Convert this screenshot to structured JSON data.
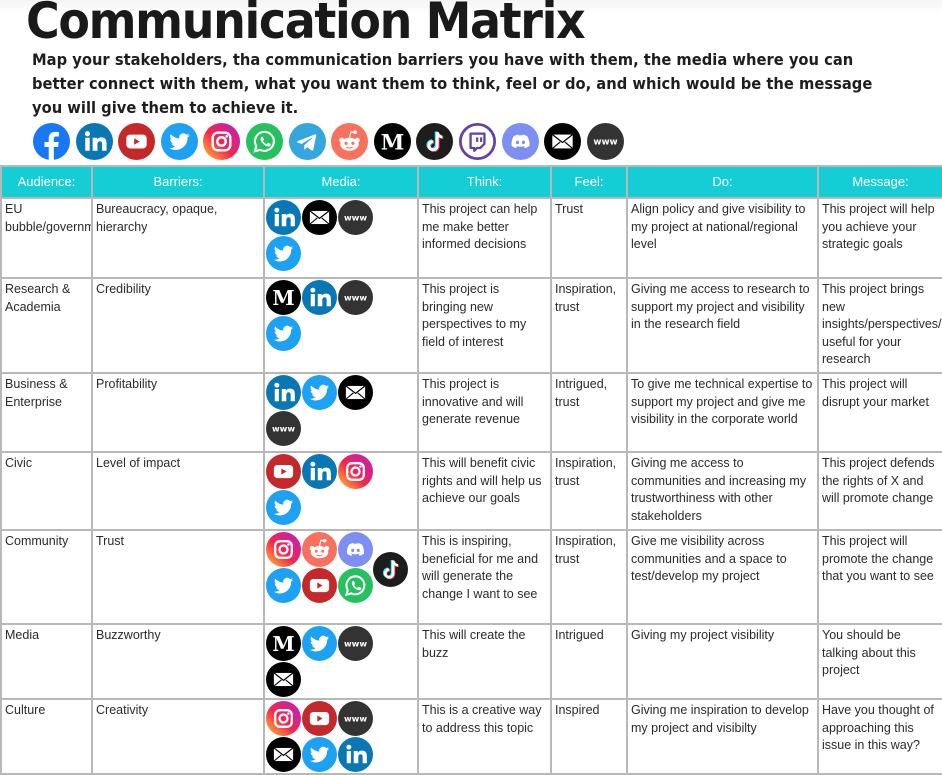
{
  "header": {
    "title": "Communication Matrix",
    "subtitle": "Map your stakeholders, tha communication barriers you have with them, the media where you can better connect with them, what you want them to think, feel or do, and which would be the message you will give them to achieve it."
  },
  "legend_icons": [
    "facebook-icon",
    "linkedin-icon",
    "youtube-icon",
    "twitter-icon",
    "instagram-icon",
    "whatsapp-icon",
    "telegram-icon",
    "reddit-icon",
    "medium-icon",
    "tiktok-icon",
    "twitch-icon",
    "discord-icon",
    "email-icon",
    "website-icon"
  ],
  "colors": {
    "header_bg": "#15ced5",
    "header_text": "#ffffff",
    "grid": "#b8b8b8",
    "facebook": "#1877f2",
    "linkedin": "#0a77b5",
    "youtube": "#c4282a",
    "twitter": "#1da1f2",
    "whatsapp": "#25c15f",
    "telegram": "#35a6de",
    "reddit": "#f8715f",
    "medium": "#000000",
    "tiktok": "#1d1d1d",
    "twitch": "#6441a5",
    "discord": "#7d8ff0",
    "email": "#000000",
    "website": "#333333"
  },
  "table": {
    "columns": [
      "Audience:",
      "Barriers:",
      "Media:",
      "Think:",
      "Feel:",
      "Do:",
      "Message:"
    ],
    "rows": [
      {
        "audience": "EU bubble/government",
        "barriers": "Bureaucracy, opaque, hierarchy",
        "media": [
          "linkedin",
          "email",
          "website",
          "twitter"
        ],
        "think": "This project can help me make better informed decisions",
        "feel": "Trust",
        "do": "Align policy and give visibility to my project at national/regional level",
        "message": "This project will help you achieve your strategic goals"
      },
      {
        "audience": "Research & Academia",
        "barriers": "Credibility",
        "media": [
          "medium",
          "linkedin",
          "website",
          "twitter"
        ],
        "think": "This project is bringing new perspectives to my field of interest",
        "feel": "Inspiration, trust",
        "do": "Giving me access to research to support my project and visibility in the research field",
        "message": "This project brings new insights/perspectives/data useful for your research"
      },
      {
        "audience": "Business & Enterprise",
        "barriers": "Profitability",
        "media": [
          "linkedin",
          "twitter",
          "email",
          "website"
        ],
        "think": "This project is innovative and will generate revenue",
        "feel": "Intrigued, trust",
        "do": "To give me technical expertise to support my project and give me visibility in the corporate world",
        "message": "This project will disrupt your market"
      },
      {
        "audience": "Civic",
        "barriers": "Level of impact",
        "media": [
          "youtube",
          "linkedin",
          "instagram",
          "twitter"
        ],
        "think": "This will benefit civic rights and will help us achieve our goals",
        "feel": "Inspiration, trust",
        "do": "Giving me access to communities and increasing my trustworthiness with other stakeholders",
        "message": "This project defends the rights of X and will promote change"
      },
      {
        "audience": "Community",
        "barriers": "Trust",
        "media": [
          "instagram",
          "reddit",
          "discord",
          "twitter",
          "youtube",
          "whatsapp",
          "tiktok"
        ],
        "think": "This is inspiring, beneficial for me and will generate the change I want to see",
        "feel": "Inspiration, trust",
        "do": "Give me visibility across communities and a space to test/develop my project",
        "message": "This project will promote the change that you want to see"
      },
      {
        "audience": "Media",
        "barriers": "Buzzworthy",
        "media": [
          "medium",
          "twitter",
          "website",
          "email"
        ],
        "think": "This will create the buzz",
        "feel": "Intrigued",
        "do": "Giving my project visibility",
        "message": "You should be talking about this project"
      },
      {
        "audience": "Culture",
        "barriers": "Creativity",
        "media": [
          "instagram",
          "youtube",
          "website",
          "email",
          "twitter",
          "linkedin"
        ],
        "think": "This is a creative way to address this topic",
        "feel": "Inspired",
        "do": "Giving me inspiration to develop my project and visibilty",
        "message": "Have you thought of approaching this issue in this way?"
      }
    ]
  }
}
